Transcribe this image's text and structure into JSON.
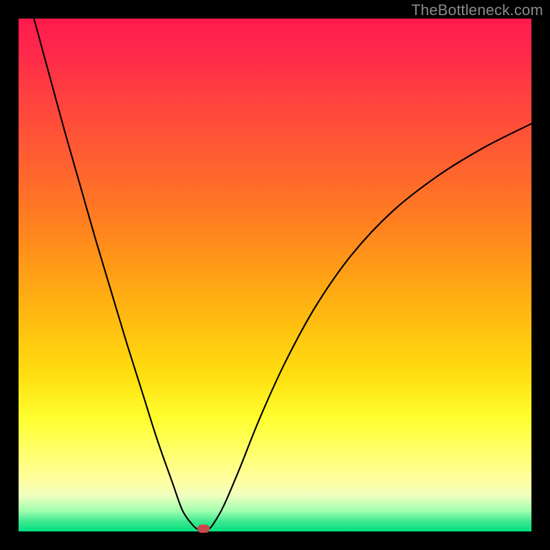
{
  "watermark": "TheBottleneck.com",
  "colors": {
    "curve": "#000000",
    "marker": "#c74a4a",
    "frame": "#000000"
  },
  "chart_data": {
    "type": "line",
    "title": "",
    "xlabel": "",
    "ylabel": "",
    "xlim": [
      0,
      100
    ],
    "ylim": [
      0,
      100
    ],
    "grid": false,
    "legend": false,
    "series": [
      {
        "name": "bottleneck-curve",
        "x": [
          3,
          6,
          9,
          12,
          15,
          18,
          21,
          24,
          27,
          30,
          32,
          34,
          35,
          36,
          37,
          38,
          40,
          43,
          47,
          52,
          58,
          65,
          73,
          82,
          91,
          100
        ],
        "y": [
          100,
          89,
          78,
          67.5,
          57,
          47,
          37,
          27.5,
          18,
          9.5,
          4,
          1.2,
          0.4,
          0.1,
          0.4,
          1.5,
          5,
          12,
          22,
          33,
          44,
          54,
          62.5,
          69.5,
          75,
          79.5
        ]
      }
    ],
    "marker": {
      "x": 36,
      "y": 0.6
    },
    "background_gradient": [
      {
        "pos": 0.0,
        "color": "#ff1a4d"
      },
      {
        "pos": 0.5,
        "color": "#ffa015"
      },
      {
        "pos": 0.78,
        "color": "#ffff30"
      },
      {
        "pos": 1.0,
        "color": "#00e080"
      }
    ]
  }
}
